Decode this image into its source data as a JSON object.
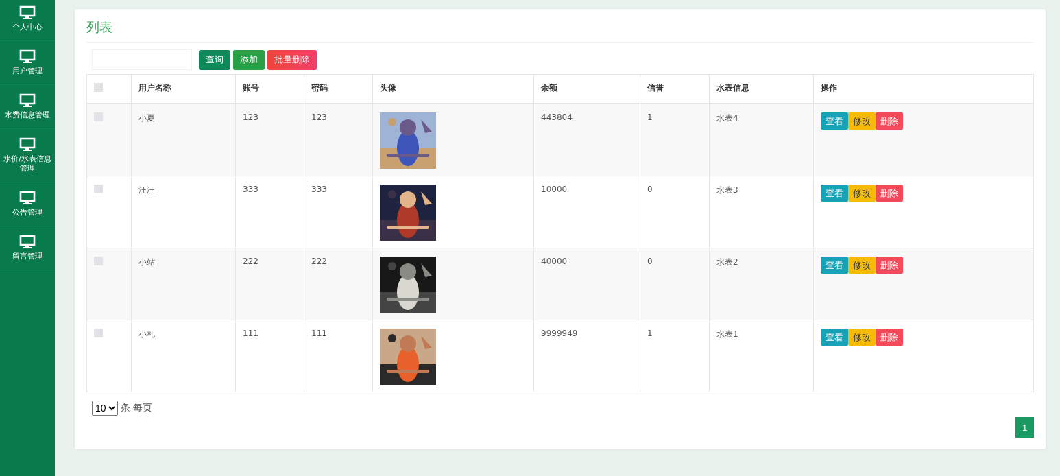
{
  "sidebar": {
    "items": [
      {
        "label": "个人中心"
      },
      {
        "label": "用户管理"
      },
      {
        "label": "水费信息管理"
      },
      {
        "label": "水价/水表信息管理"
      },
      {
        "label": "公告管理"
      },
      {
        "label": "留言管理"
      }
    ]
  },
  "panel": {
    "title": "列表",
    "buttons": [
      {
        "label": "查询",
        "kind": "search"
      },
      {
        "label": "添加",
        "kind": "add"
      },
      {
        "label": "批量删除",
        "kind": "delete"
      }
    ]
  },
  "table": {
    "select_all": {
      "checked": false
    },
    "columns": [
      "用户名称",
      "账号",
      "密码",
      "头像",
      "余额",
      "信誉",
      "水表信息",
      "操作"
    ],
    "rows": [
      {
        "checked": false,
        "name": "小夏",
        "account": "123",
        "password": "123",
        "avatar": {
          "kind": "picture"
        },
        "balance": "443804",
        "credit": "1",
        "meter": "水表4",
        "actions": [
          "查看",
          "修改",
          "删除"
        ]
      },
      {
        "checked": false,
        "name": "汪汪",
        "account": "333",
        "password": "333",
        "avatar": {
          "kind": "picture"
        },
        "balance": "10000",
        "credit": "0",
        "meter": "水表3",
        "actions": [
          "查看",
          "修改",
          "删除"
        ]
      },
      {
        "checked": false,
        "name": "小站",
        "account": "222",
        "password": "222",
        "avatar": {
          "kind": "picture"
        },
        "balance": "40000",
        "credit": "0",
        "meter": "水表2",
        "actions": [
          "查看",
          "修改",
          "删除"
        ]
      },
      {
        "checked": false,
        "name": "小札",
        "account": "111",
        "password": "111",
        "avatar": {
          "kind": "picture"
        },
        "balance": "9999949",
        "credit": "1",
        "meter": "水表1",
        "actions": [
          "查看",
          "修改",
          "删除"
        ]
      }
    ]
  },
  "pagination": {
    "page_size": "10",
    "page_size_label": "条 每页",
    "pages": [
      {
        "label": "1",
        "selected": true
      }
    ]
  }
}
